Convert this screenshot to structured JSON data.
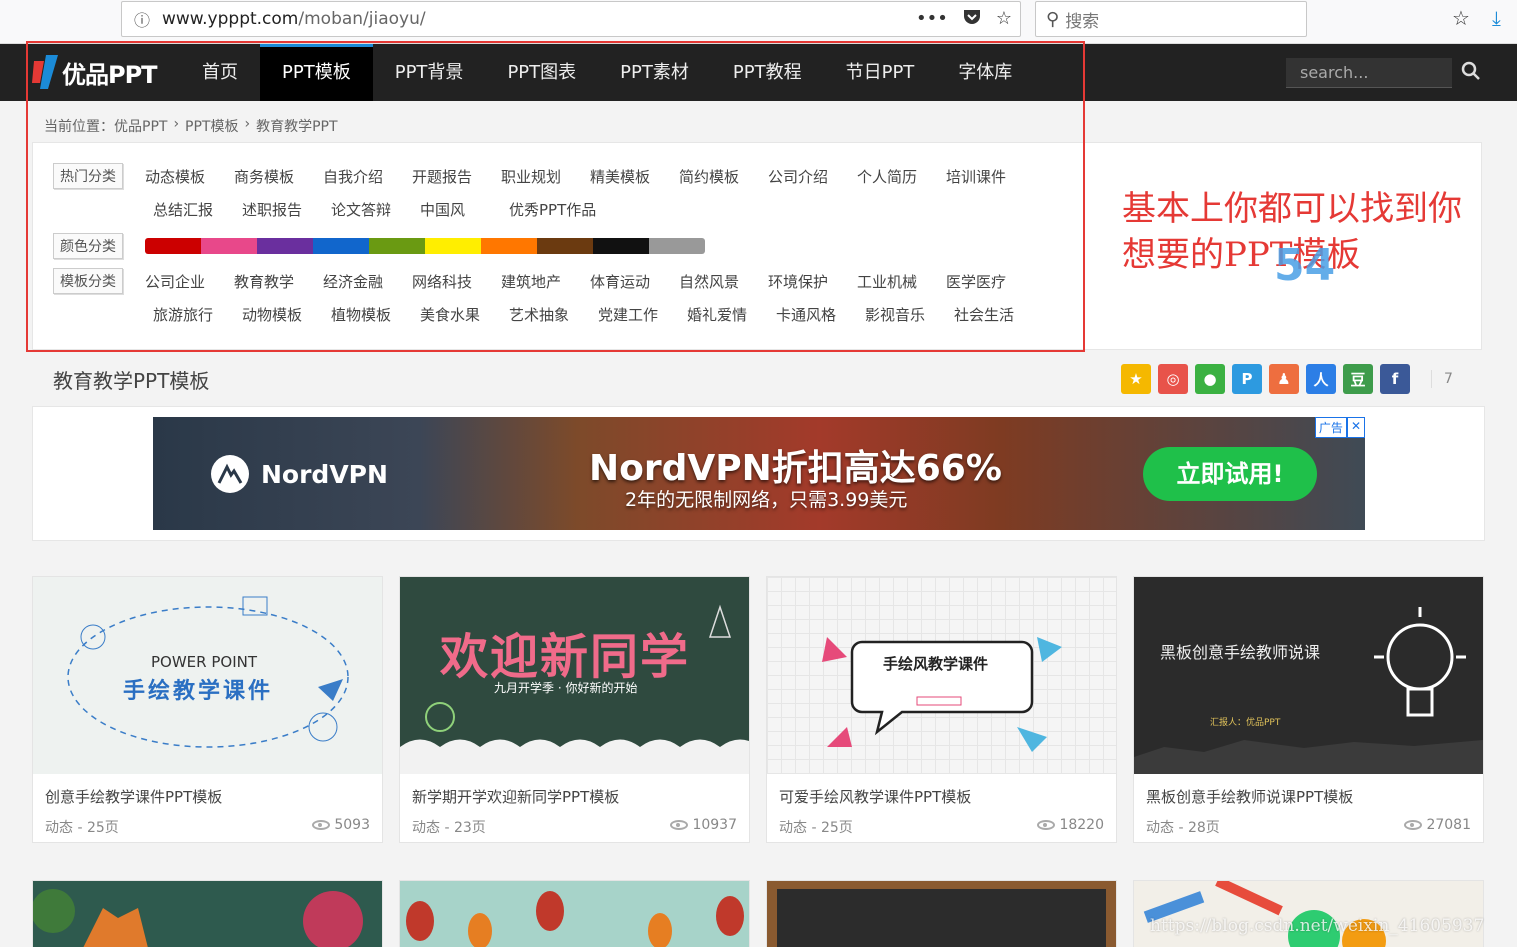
{
  "browser": {
    "url_host": "www.ypppt.com",
    "url_path": "/moban/jiaoyu/",
    "search_placeholder": "搜索"
  },
  "site": {
    "logo_text": "优品PPT",
    "nav": [
      "首页",
      "PPT模板",
      "PPT背景",
      "PPT图表",
      "PPT素材",
      "PPT教程",
      "节日PPT",
      "字体库"
    ],
    "active_nav": "PPT模板",
    "search_placeholder": "search..."
  },
  "breadcrumb": {
    "prefix": "当前位置：",
    "items": [
      "优品PPT",
      "PPT模板",
      "教育教学PPT"
    ]
  },
  "categories": {
    "hot_label": "热门分类",
    "hot_row1": [
      "动态模板",
      "商务模板",
      "自我介绍",
      "开题报告",
      "职业规划",
      "精美模板",
      "简约模板",
      "公司介绍",
      "个人简历",
      "培训课件"
    ],
    "hot_row2": [
      "总结汇报",
      "述职报告",
      "论文答辩",
      "中国风",
      "优秀PPT作品"
    ],
    "color_label": "颜色分类",
    "colors": [
      "#cc0000",
      "#e8488a",
      "#6a2f9e",
      "#1166cc",
      "#6a9a12",
      "#ffee00",
      "#ff7700",
      "#6b3a10",
      "#111111",
      "#999999"
    ],
    "template_label": "模板分类",
    "template_row1": [
      "公司企业",
      "教育教学",
      "经济金融",
      "网络科技",
      "建筑地产",
      "体育运动",
      "自然风景",
      "环境保护",
      "工业机械",
      "医学医疗"
    ],
    "template_row2": [
      "旅游旅行",
      "动物模板",
      "植物模板",
      "美食水果",
      "艺术抽象",
      "党建工作",
      "婚礼爱情",
      "卡通风格",
      "影视音乐",
      "社会生活"
    ]
  },
  "annotation": {
    "line1": "基本上你都可以找到你",
    "line2": "想要的PPT模板",
    "overlay_num": "54"
  },
  "section": {
    "title": "教育教学PPT模板",
    "share_count": "7"
  },
  "ad": {
    "brand": "NordVPN",
    "headline": "NordVPN折扣高达66%",
    "sub": "2年的无限制网络，只需3.99美元",
    "cta": "立即试用!",
    "badge": "广告"
  },
  "cards": [
    {
      "title": "创意手绘教学课件PPT模板",
      "meta": "动态 - 25页",
      "views": "5093",
      "thumb_line1": "POWER POINT",
      "thumb_line2": "手绘教学课件"
    },
    {
      "title": "新学期开学欢迎新同学PPT模板",
      "meta": "动态 - 23页",
      "views": "10937",
      "thumb_line1": "欢迎新同学",
      "thumb_line2": "九月开学季 · 你好新的开始"
    },
    {
      "title": "可爱手绘风教学课件PPT模板",
      "meta": "动态 - 25页",
      "views": "18220",
      "thumb_line1": "手绘风教学课件",
      "thumb_line2": ""
    },
    {
      "title": "黑板创意手绘教师说课PPT模板",
      "meta": "动态 - 28页",
      "views": "27081",
      "thumb_line1": "黑板创意手绘教师说课",
      "thumb_line2": "汇报人：优品PPT"
    }
  ],
  "watermark": "https://blog.csdn.net/weixin_41605937"
}
